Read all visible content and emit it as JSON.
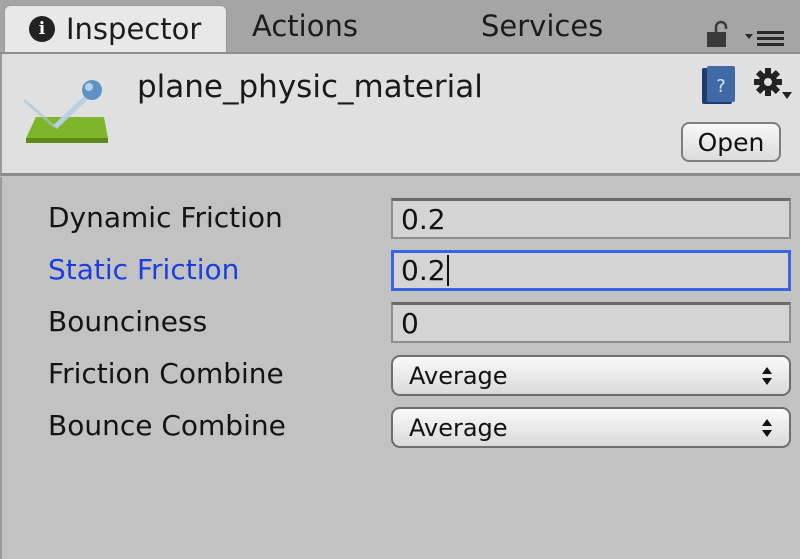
{
  "tabs": [
    {
      "label": "Inspector",
      "icon": "info-icon",
      "active": true
    },
    {
      "label": "Actions",
      "active": false
    },
    {
      "label": "Services",
      "active": false
    }
  ],
  "tabbar": {
    "info_glyph": "i",
    "lock": "lock-open-icon",
    "menu": "tab-menu-icon"
  },
  "header": {
    "asset_name": "plane_physic_material",
    "asset_icon": "physic-material-icon",
    "open_label": "Open"
  },
  "properties": [
    {
      "label": "Dynamic Friction",
      "type": "float",
      "value": "0.2",
      "focused": false
    },
    {
      "label": "Static Friction",
      "type": "float",
      "value": "0.2",
      "focused": true
    },
    {
      "label": "Bounciness",
      "type": "float",
      "value": "0",
      "focused": false
    },
    {
      "label": "Friction Combine",
      "type": "enum",
      "value": "Average",
      "focused": false
    },
    {
      "label": "Bounce Combine",
      "type": "enum",
      "value": "Average",
      "focused": false
    }
  ],
  "colors": {
    "focus_label": "#1a3ee0",
    "focus_border": "#3a64e0",
    "asset_green": "#7fb52a"
  }
}
